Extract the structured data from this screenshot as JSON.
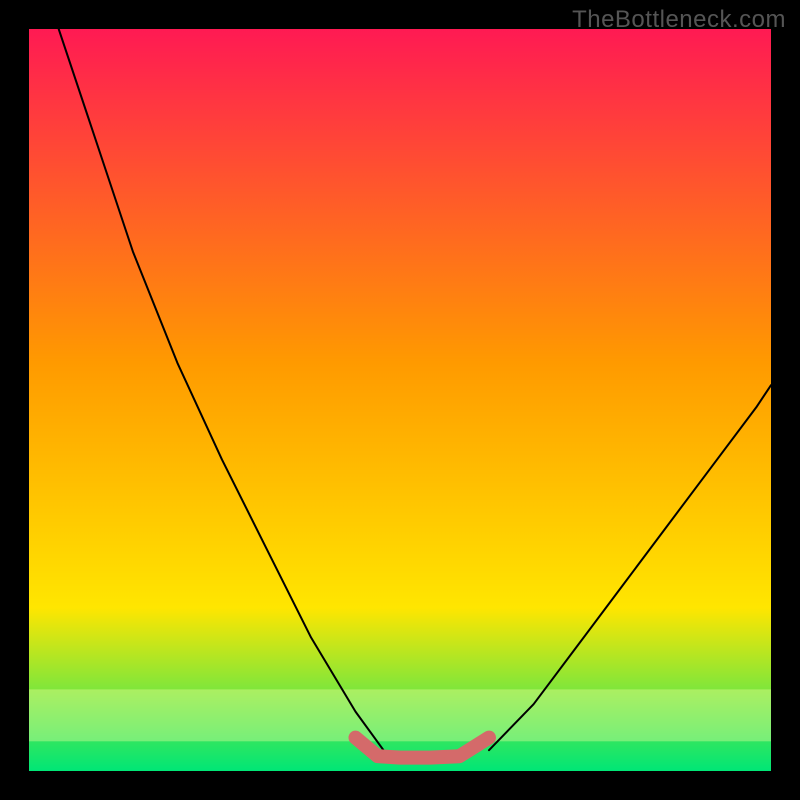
{
  "watermark": "TheBottleneck.com",
  "chart_data": {
    "type": "line",
    "title": "",
    "xlabel": "",
    "ylabel": "",
    "xlim": [
      0,
      1
    ],
    "ylim": [
      0,
      1
    ],
    "background_gradient": {
      "top": "#ff1a53",
      "mid1": "#ff9a00",
      "mid2": "#ffe600",
      "bottom": "#00e676"
    },
    "pale_band": {
      "y_start": 0.11,
      "y_end": 0.04,
      "color": "#ffffa8",
      "opacity": 0.35
    },
    "series": [
      {
        "name": "left-branch",
        "color": "#000000",
        "width": 2,
        "x": [
          0.04,
          0.08,
          0.14,
          0.2,
          0.26,
          0.32,
          0.38,
          0.44,
          0.48
        ],
        "y": [
          1.0,
          0.88,
          0.7,
          0.55,
          0.42,
          0.3,
          0.18,
          0.08,
          0.025
        ]
      },
      {
        "name": "right-branch",
        "color": "#000000",
        "width": 2,
        "x": [
          0.62,
          0.68,
          0.74,
          0.8,
          0.86,
          0.92,
          0.98,
          1.0
        ],
        "y": [
          0.028,
          0.09,
          0.17,
          0.25,
          0.33,
          0.41,
          0.49,
          0.52
        ]
      },
      {
        "name": "bottom-highlight",
        "color": "#d46a6a",
        "width": 14,
        "x": [
          0.44,
          0.47,
          0.5,
          0.54,
          0.58,
          0.62
        ],
        "y": [
          0.045,
          0.02,
          0.018,
          0.018,
          0.02,
          0.045
        ]
      }
    ]
  }
}
